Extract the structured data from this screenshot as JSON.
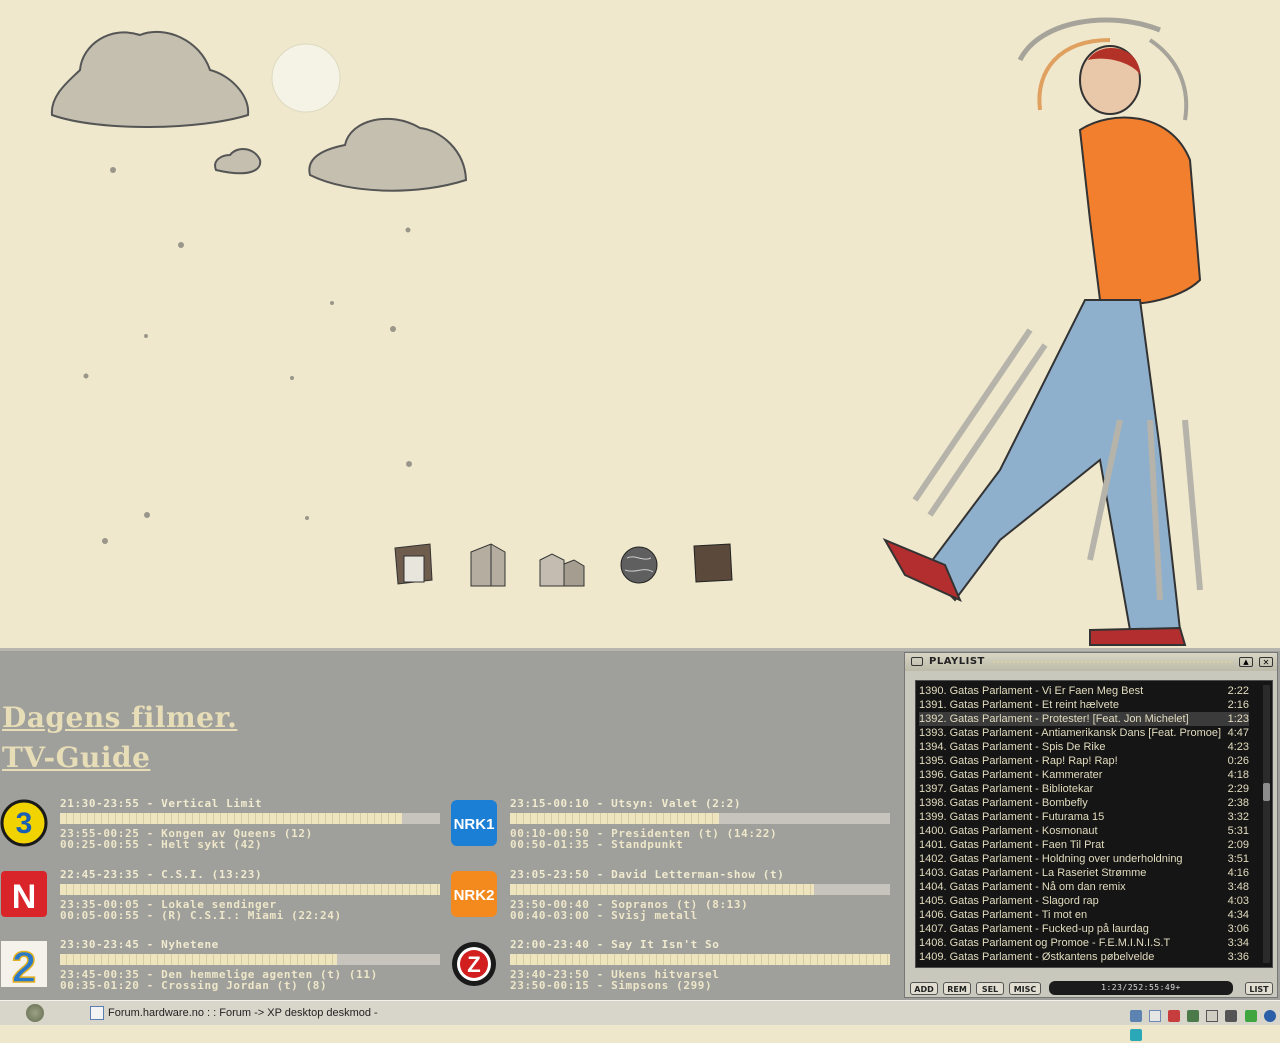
{
  "desktop": {
    "icons": [
      "document-folder-icon",
      "building-icon",
      "city-icon",
      "globe-icon",
      "folder-icon"
    ]
  },
  "tvguide": {
    "title1": "Dagens filmer.",
    "title2": "TV-Guide",
    "channels": [
      {
        "name": "TV3",
        "color": "#f0d300",
        "now": "21:30-23:55 - Vertical Limit",
        "progress": 0.9,
        "next1": "23:55-00:25 - Kongen av Queens (12)",
        "next2": "00:25-00:55 - Helt sykt (42)"
      },
      {
        "name": "NRK1",
        "color": "#1b7fd6",
        "now": "23:15-00:10 - Utsyn: Valet (2:2)",
        "progress": 0.55,
        "next1": "00:10-00:50 - Presidenten (t) (14:22)",
        "next2": "00:50-01:35 - Standpunkt"
      },
      {
        "name": "TVNorge",
        "color": "#d9242a",
        "now": "22:45-23:35 - C.S.I. (13:23)",
        "progress": 1.0,
        "next1": "23:35-00:05 - Lokale sendinger",
        "next2": "00:05-00:55 - (R) C.S.I.: Miami (22:24)"
      },
      {
        "name": "NRK2",
        "color": "#f48a1e",
        "now": "23:05-23:50 - David Letterman-show (t)",
        "progress": 0.8,
        "next1": "23:50-00:40 - Sopranos (t) (8:13)",
        "next2": "00:40-03:00 - Svisj metall"
      },
      {
        "name": "TV2",
        "color": "#2a78c8",
        "now": "23:30-23:45 - Nyhetene",
        "progress": 0.73,
        "next1": "23:45-00:35 - Den hemmelige agenten (t) (11)",
        "next2": "00:35-01:20 - Crossing Jordan (t) (8)"
      },
      {
        "name": "ZTV",
        "color": "#222222",
        "now": "22:00-23:40 - Say It Isn't So",
        "progress": 1.0,
        "next1": "23:40-23:50 - Ukens hitvarsel",
        "next2": "23:50-00:15 - Simpsons (299)"
      }
    ]
  },
  "playlist": {
    "title": "PLAYLIST",
    "tracks": [
      {
        "title": "1390. Gatas Parlament - Vi Er Faen Meg Best",
        "dur": "2:22"
      },
      {
        "title": "1391. Gatas Parlament - Et reint hælvete",
        "dur": "2:16"
      },
      {
        "title": "1392. Gatas Parlament - Protester! [Feat. Jon Michelet]",
        "dur": "1:23"
      },
      {
        "title": "1393. Gatas Parlament - Antiamerikansk Dans [Feat. Promoe]",
        "dur": "4:47"
      },
      {
        "title": "1394. Gatas Parlament - Spis De Rike",
        "dur": "4:23"
      },
      {
        "title": "1395. Gatas Parlament - Rap! Rap! Rap!",
        "dur": "0:26"
      },
      {
        "title": "1396. Gatas Parlament - Kammerater",
        "dur": "4:18"
      },
      {
        "title": "1397. Gatas Parlament - Bibliotekar",
        "dur": "2:29"
      },
      {
        "title": "1398. Gatas Parlament - Bombefly",
        "dur": "2:38"
      },
      {
        "title": "1399. Gatas Parlament - Futurama 15",
        "dur": "3:32"
      },
      {
        "title": "1400. Gatas Parlament - Kosmonaut",
        "dur": "5:31"
      },
      {
        "title": "1401. Gatas Parlament - Faen Til Prat",
        "dur": "2:09"
      },
      {
        "title": "1402. Gatas Parlament - Holdning over underholdning",
        "dur": "3:51"
      },
      {
        "title": "1403. Gatas Parlament - La Raseriet Strømme",
        "dur": "4:16"
      },
      {
        "title": "1404. Gatas Parlament - Nå om dan remix",
        "dur": "3:48"
      },
      {
        "title": "1405. Gatas Parlament - Slagord rap",
        "dur": "4:03"
      },
      {
        "title": "1406. Gatas Parlament - Ti mot en",
        "dur": "4:34"
      },
      {
        "title": "1407. Gatas Parlament - Fucked-up på laurdag",
        "dur": "3:06"
      },
      {
        "title": "1408. Gatas Parlament og Promoe - F.E.M.I.N.I.S.T",
        "dur": "3:34"
      },
      {
        "title": "1409. Gatas Parlament - Østkantens pøbelvelde",
        "dur": "3:36"
      }
    ],
    "selected_index": 2,
    "buttons": {
      "add": "ADD",
      "rem": "REM",
      "sel": "SEL",
      "misc": "MISC",
      "list": "LIST"
    },
    "time": "1:23/252:55:49+"
  },
  "taskbar": {
    "task_label": "Forum.hardware.no : : Forum -> XP desktop deskmod -"
  }
}
